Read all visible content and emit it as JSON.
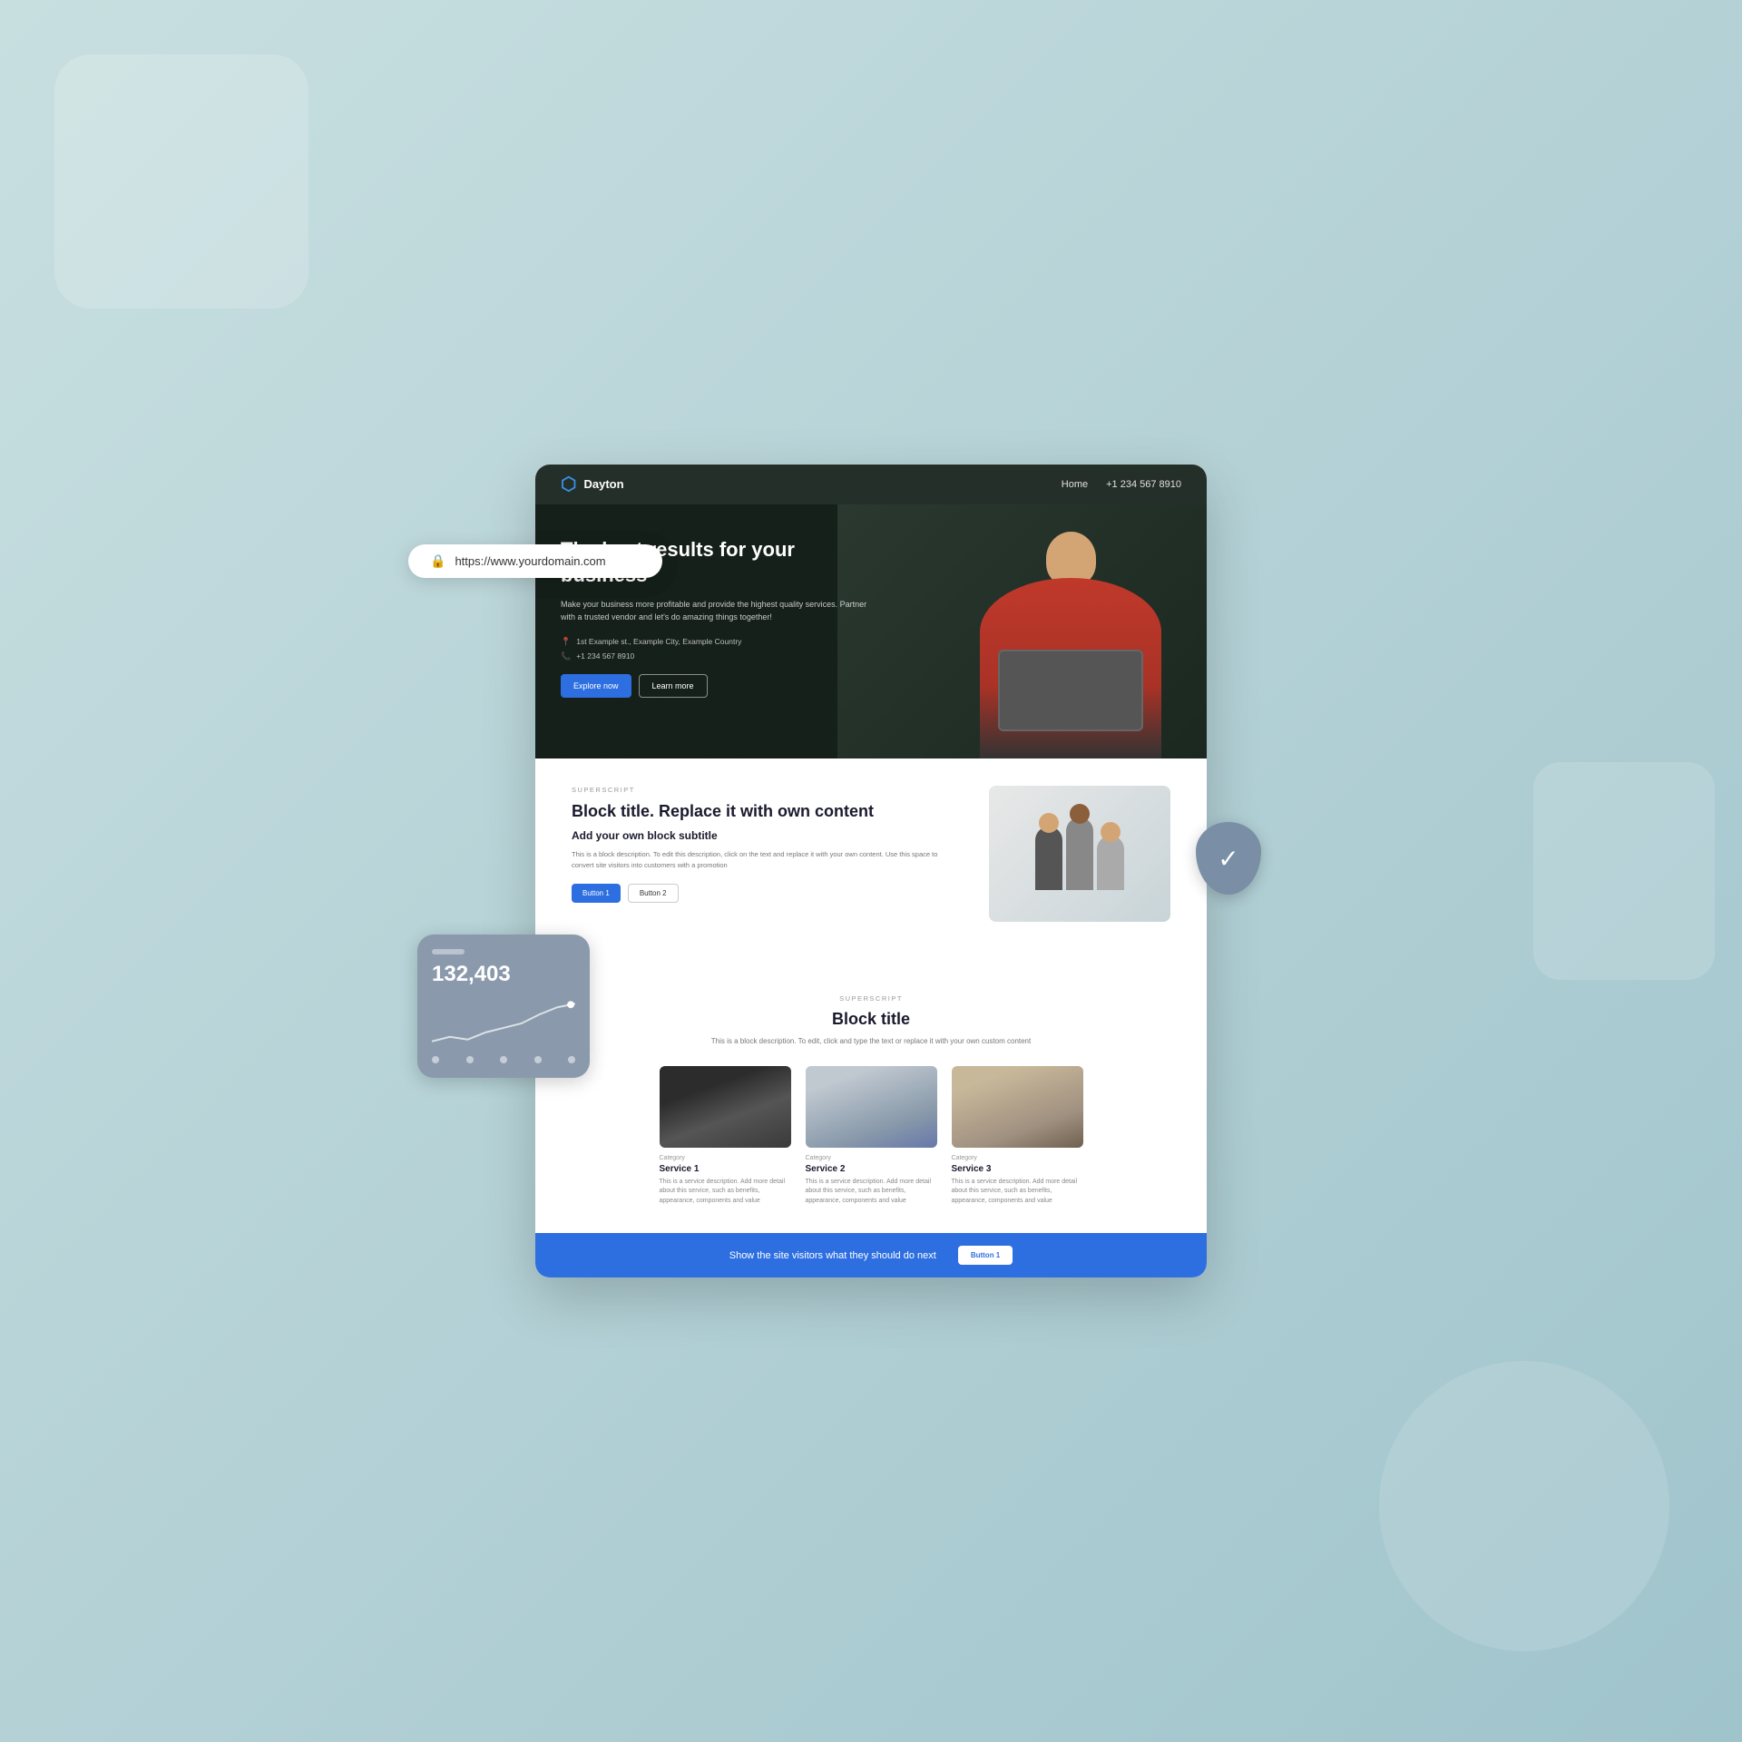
{
  "page": {
    "background": "#b8d4da",
    "url": "https://www.yourdomain.com"
  },
  "nav": {
    "logo_icon": "D",
    "logo_text": "Dayton",
    "links": [
      {
        "label": "Home"
      },
      {
        "label": "+1 234 567 8910"
      }
    ]
  },
  "hero": {
    "title": "The best results for your business",
    "description": "Make your business more profitable and provide the highest quality services. Partner with a trusted vendor and let's do amazing things together!",
    "address": "1st Example st., Example City, Example Country",
    "phone": "+1 234 567 8910",
    "btn_primary": "Explore now",
    "btn_secondary": "Learn more"
  },
  "block1": {
    "superscript": "SUPERSCRIPT",
    "title": "Block title. Replace it with own content",
    "subtitle": "Add your own block subtitle",
    "description": "This is a block description. To edit this description, click on the text and replace it with your own content. Use this space to convert site visitors into customers with a promotion",
    "btn1": "Button 1",
    "btn2": "Button 2"
  },
  "block2": {
    "superscript": "SUPERSCRIPT",
    "title": "Block title",
    "description": "This is a block description. To edit, click and type the text or replace it with your own custom content"
  },
  "services": [
    {
      "category": "Category",
      "name": "Service 1",
      "description": "This is a service description. Add more detail about this service, such as benefits, appearance, components and value"
    },
    {
      "category": "Category",
      "name": "Service 2",
      "description": "This is a service description. Add more detail about this service, such as benefits, appearance, components and value"
    },
    {
      "category": "Category",
      "name": "Service 3",
      "description": "This is a service description. Add more detail about this service, such as benefits, appearance, components and value"
    }
  ],
  "cta": {
    "text": "Show the site visitors what they should do next",
    "button": "Button 1"
  },
  "stats": {
    "number": "132,403"
  }
}
